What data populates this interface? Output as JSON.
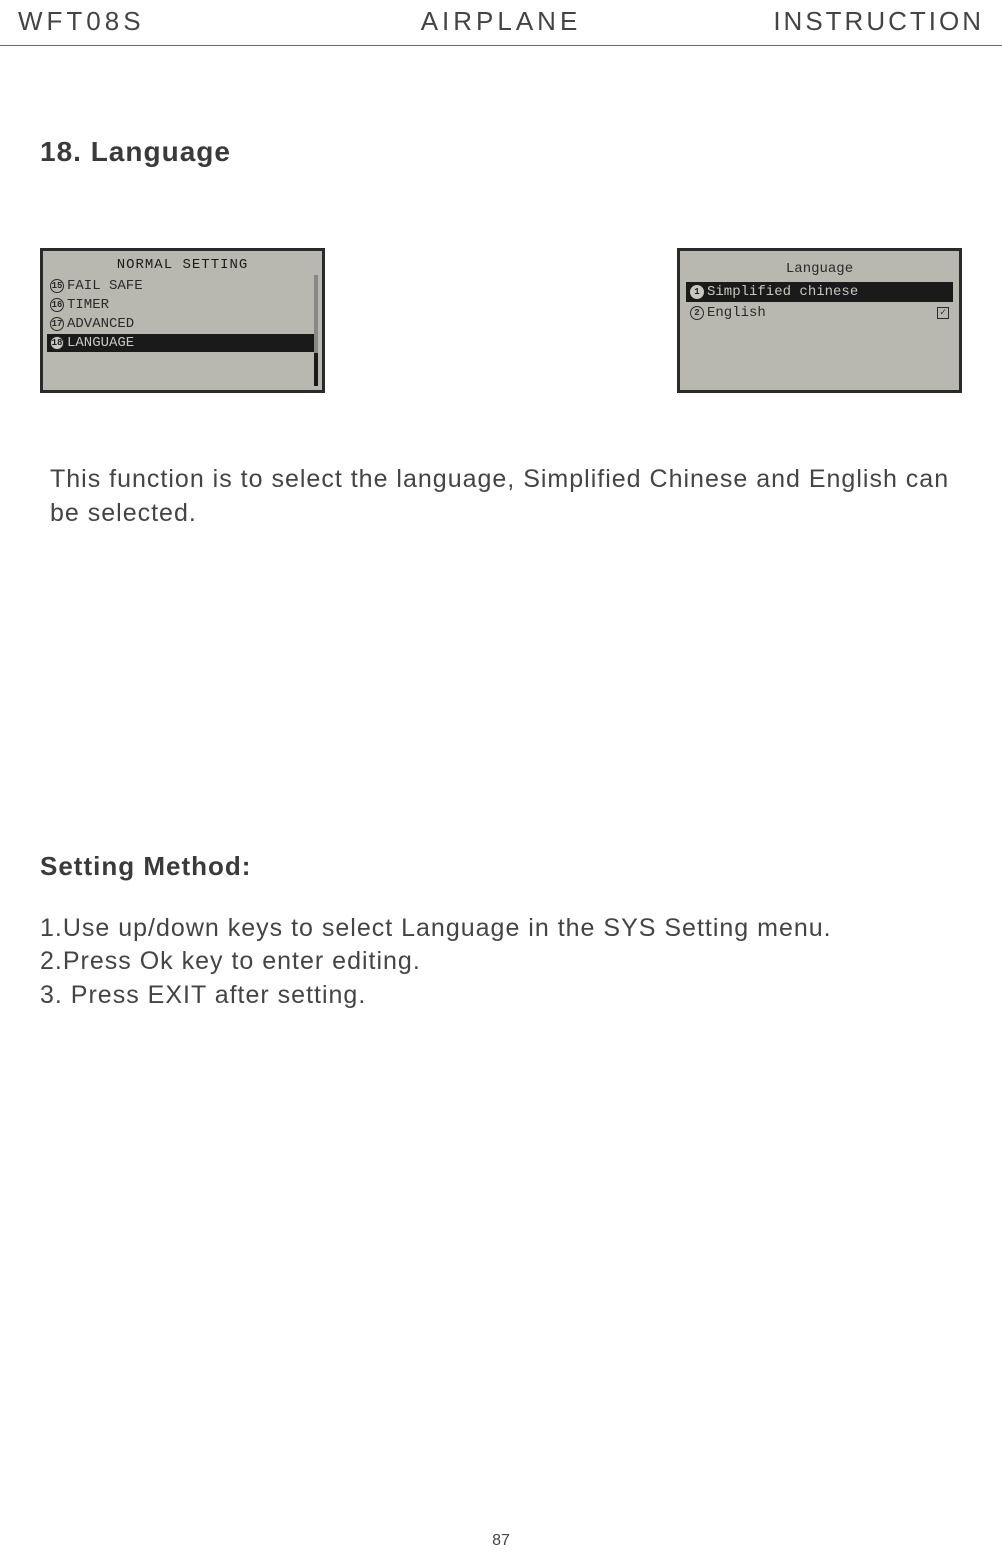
{
  "header": {
    "left": "WFT08S",
    "center": "AIRPLANE",
    "right": "INSTRUCTION"
  },
  "section_title": "18. Language",
  "lcd_left": {
    "title": "NORMAL SETTING",
    "rows": [
      {
        "num": "15",
        "label": "FAIL SAFE",
        "selected": false
      },
      {
        "num": "16",
        "label": "TIMER",
        "selected": false
      },
      {
        "num": "17",
        "label": "ADVANCED",
        "selected": false
      },
      {
        "num": "18",
        "label": "LANGUAGE",
        "selected": true
      }
    ]
  },
  "lcd_right": {
    "title": "Language",
    "rows": [
      {
        "num": "1",
        "label": "Simplified chinese",
        "selected": true,
        "checked": false
      },
      {
        "num": "2",
        "label": "English",
        "selected": false,
        "checked": true
      }
    ]
  },
  "description": "This function is to select the language, Simplified Chinese and English can be selected.",
  "setting_method_title": "Setting Method:",
  "steps": [
    "1.Use up/down keys  to select Language in the SYS Setting menu.",
    "2.Press Ok key to enter editing.",
    "3. Press EXIT after setting."
  ],
  "page_number": "87"
}
